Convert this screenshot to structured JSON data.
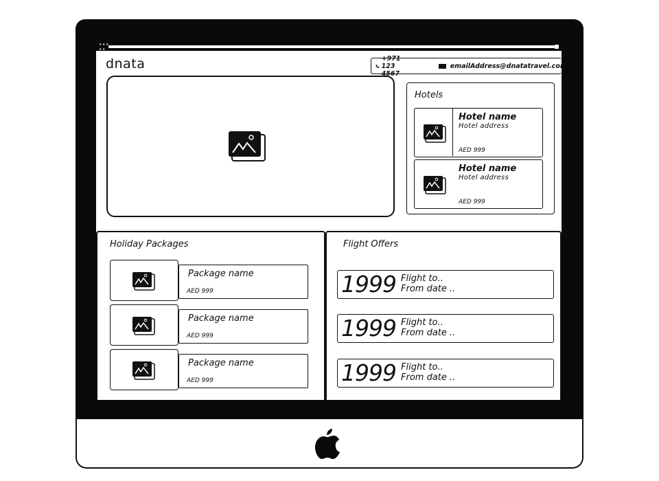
{
  "header": {
    "logo": "dnata",
    "phone": "+971 123 4567",
    "email": "emailAddress@dnatatravel.com"
  },
  "hotels": {
    "title": "Hotels",
    "items": [
      {
        "name": "Hotel name",
        "address": "Hotel address",
        "price": "AED 999"
      },
      {
        "name": "Hotel name",
        "address": "Hotel address",
        "price": "AED 999"
      }
    ]
  },
  "packages": {
    "title": "Holiday Packages",
    "items": [
      {
        "name": "Package name",
        "price": "AED 999"
      },
      {
        "name": "Package name",
        "price": "AED 999"
      },
      {
        "name": "Package name",
        "price": "AED 999"
      }
    ]
  },
  "flights": {
    "title": "Flight Offers",
    "items": [
      {
        "price": "1999",
        "to": "Flight to..",
        "date": "From date .."
      },
      {
        "price": "1999",
        "to": "Flight to..",
        "date": "From date .."
      },
      {
        "price": "1999",
        "to": "Flight to..",
        "date": "From date .."
      }
    ]
  },
  "icons": {
    "image_placeholder": "image-icon",
    "phone": "phone-icon",
    "mail": "mail-icon",
    "brand": "apple-logo-icon"
  },
  "colors": {
    "ink": "#111111",
    "bezel": "#0a0a0a",
    "background": "#ffffff"
  }
}
